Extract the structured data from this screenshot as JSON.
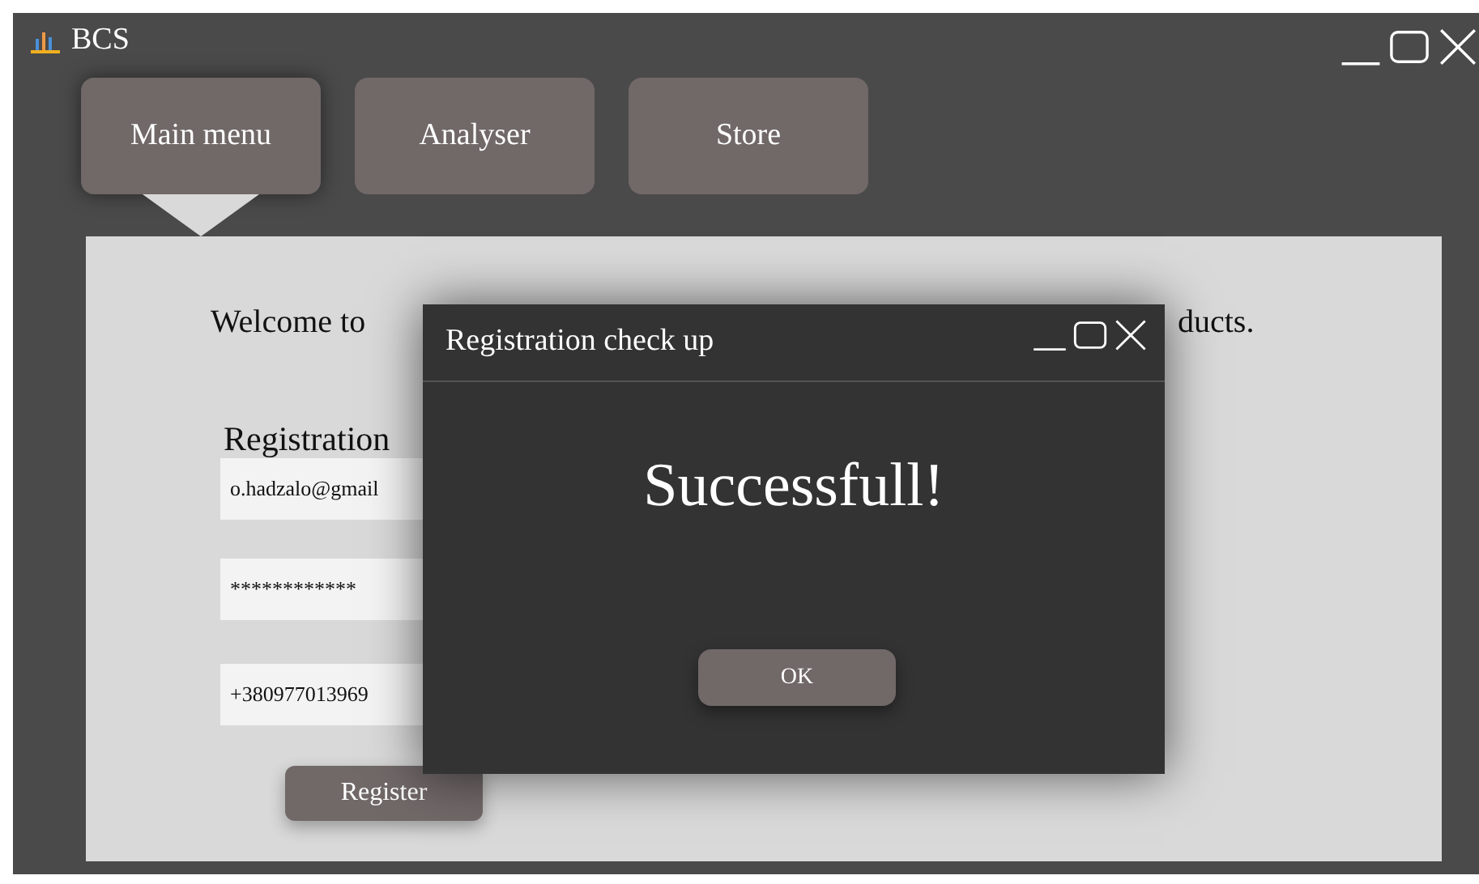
{
  "window": {
    "title": "BCS"
  },
  "tabs": [
    {
      "label": "Main menu",
      "selected": true
    },
    {
      "label": "Analyser",
      "selected": false
    },
    {
      "label": "Store",
      "selected": false
    }
  ],
  "welcome": {
    "start": "Welcome to",
    "end": "ducts."
  },
  "registration": {
    "title": "Registration",
    "fields": [
      {
        "value": "o.hadzalo@gmail"
      },
      {
        "value": "************"
      },
      {
        "value": "+380977013969"
      }
    ],
    "button": "Register"
  },
  "dialog": {
    "title": "Registration check up",
    "message": "Successfull!",
    "button": "OK"
  }
}
